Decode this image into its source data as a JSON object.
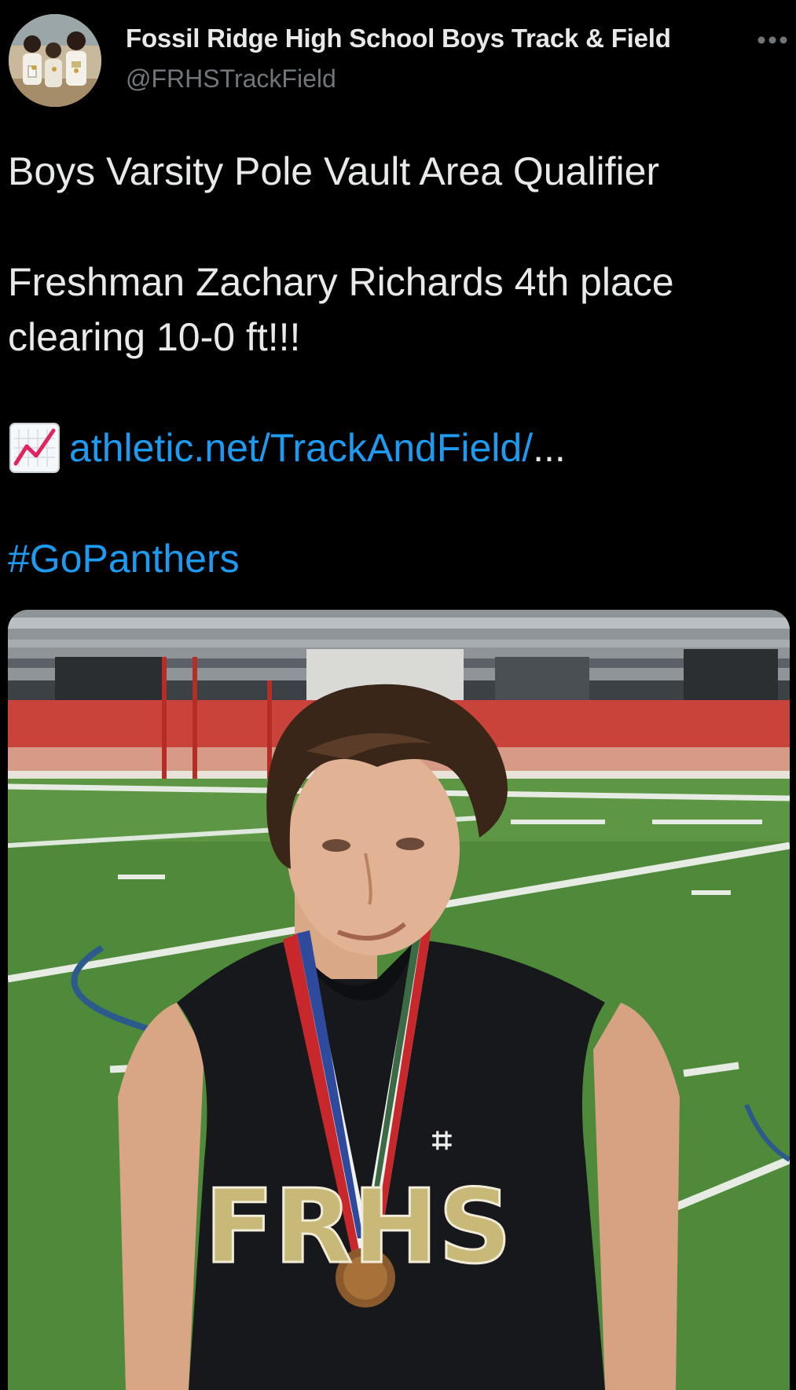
{
  "author": {
    "display_name": "Fossil Ridge High School Boys Track & Field",
    "handle": "@FRHSTrackField",
    "avatar_icon": "team-avatar-photo"
  },
  "menu": {
    "more_icon": "more-horizontal-icon"
  },
  "tweet": {
    "line1": "Boys Varsity Pole Vault Area Qualifier",
    "line2": "Freshman Zachary Richards 4th place",
    "line3": "clearing 10-0 ft!!!",
    "link_icon": "chart-increasing-icon",
    "link_text": "athletic.net/TrackAndField/",
    "link_ellipsis": "...",
    "hashtag": "#GoPanthers"
  },
  "media": {
    "jersey_text": "FRHS",
    "colors": {
      "track": "#d23b2e",
      "turf": "#4f8a3a",
      "jersey": "#17181c",
      "lettering": "#c9b978",
      "hair": "#3a2618"
    }
  },
  "colors": {
    "background": "#000000",
    "text": "#e7e9ea",
    "secondary": "#71767b",
    "link": "#1d9bf0"
  }
}
